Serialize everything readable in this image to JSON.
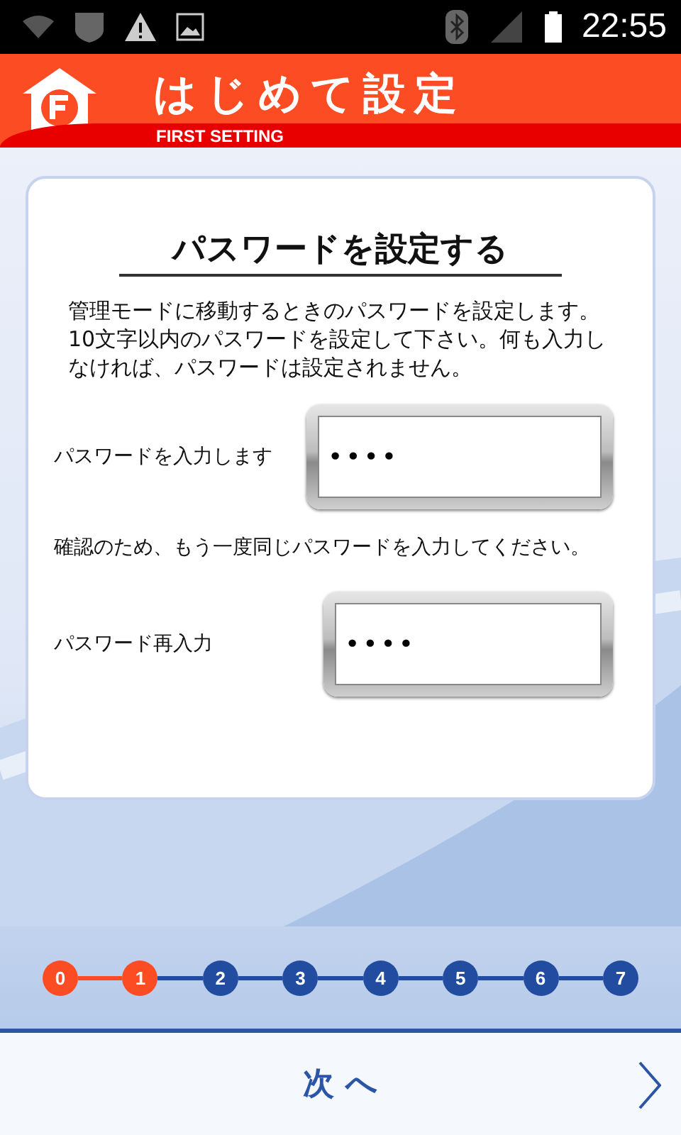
{
  "status_bar": {
    "time": "22:55"
  },
  "header": {
    "title": "はじめて設定",
    "subtitle": "FIRST SETTING"
  },
  "card": {
    "heading": "パスワードを設定する",
    "description": "管理モードに移動するときのパスワードを設定します。10文字以内のパスワードを設定して下さい。何も入力しなければ、パスワードは設定されません。",
    "fields": [
      {
        "label": "パスワードを入力します",
        "value": "••••"
      },
      {
        "note": "確認のため、もう一度同じパスワードを入力してください。",
        "label": "パスワード再入力",
        "value": "••••"
      }
    ]
  },
  "steps": [
    {
      "label": "0",
      "done": true
    },
    {
      "label": "1",
      "done": true
    },
    {
      "label": "2",
      "done": false
    },
    {
      "label": "3",
      "done": false
    },
    {
      "label": "4",
      "done": false
    },
    {
      "label": "5",
      "done": false
    },
    {
      "label": "6",
      "done": false
    },
    {
      "label": "7",
      "done": false
    }
  ],
  "next_button": {
    "label": "次 へ"
  }
}
